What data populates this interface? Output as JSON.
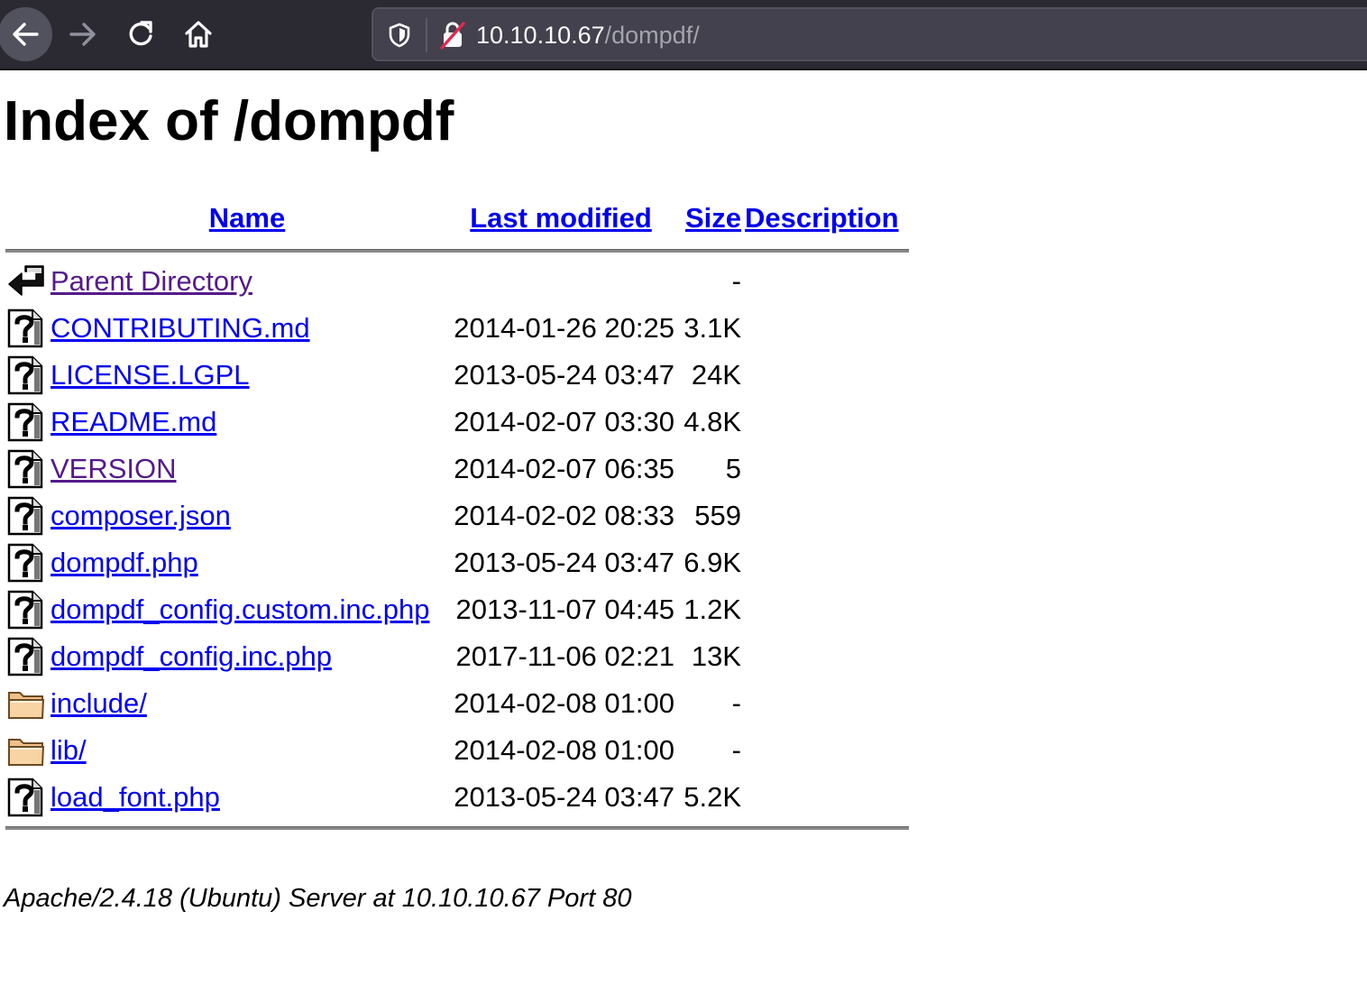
{
  "browser": {
    "url_host": "10.10.10.67",
    "url_path": "/dompdf/"
  },
  "page": {
    "title": "Index of /dompdf",
    "columns": {
      "name": "Name",
      "last_modified": "Last modified",
      "size": "Size",
      "description": "Description"
    },
    "parent": {
      "name": "Parent Directory",
      "size": "-"
    },
    "rows": [
      {
        "name": "CONTRIBUTING.md",
        "date": "2014-01-26 20:25",
        "size": "3.1K",
        "icon": "unknown-file-icon",
        "visited": false
      },
      {
        "name": "LICENSE.LGPL",
        "date": "2013-05-24 03:47",
        "size": "24K",
        "icon": "unknown-file-icon",
        "visited": false
      },
      {
        "name": "README.md",
        "date": "2014-02-07 03:30",
        "size": "4.8K",
        "icon": "unknown-file-icon",
        "visited": false
      },
      {
        "name": "VERSION",
        "date": "2014-02-07 06:35",
        "size": "5",
        "icon": "unknown-file-icon",
        "visited": true
      },
      {
        "name": "composer.json",
        "date": "2014-02-02 08:33",
        "size": "559",
        "icon": "unknown-file-icon",
        "visited": false
      },
      {
        "name": "dompdf.php",
        "date": "2013-05-24 03:47",
        "size": "6.9K",
        "icon": "unknown-file-icon",
        "visited": false
      },
      {
        "name": "dompdf_config.custom.inc.php",
        "date": "2013-11-07 04:45",
        "size": "1.2K",
        "icon": "unknown-file-icon",
        "visited": false
      },
      {
        "name": "dompdf_config.inc.php",
        "date": "2017-11-06 02:21",
        "size": "13K",
        "icon": "unknown-file-icon",
        "visited": false
      },
      {
        "name": "include/",
        "date": "2014-02-08 01:00",
        "size": "-",
        "icon": "folder-icon",
        "visited": false
      },
      {
        "name": "lib/",
        "date": "2014-02-08 01:00",
        "size": "-",
        "icon": "folder-icon",
        "visited": false
      },
      {
        "name": "load_font.php",
        "date": "2013-05-24 03:47",
        "size": "5.2K",
        "icon": "unknown-file-icon",
        "visited": false
      }
    ],
    "footer": "Apache/2.4.18 (Ubuntu) Server at 10.10.10.67 Port 80"
  },
  "colors": {
    "toolbar_bg": "#2b2a33",
    "urlbar_bg": "#42414d",
    "link": "#0000ee",
    "link_visited": "#551a8b"
  }
}
